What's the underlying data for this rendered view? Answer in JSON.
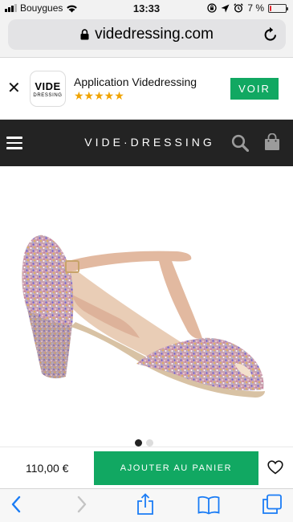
{
  "status_bar": {
    "carrier": "Bouygues",
    "time": "13:33",
    "battery_percent": "7 %",
    "battery_level": 0.07
  },
  "browser": {
    "url": "videdressing.com",
    "icons": [
      "lock-icon",
      "reload-icon"
    ]
  },
  "app_banner": {
    "logo_line1": "VIDE",
    "logo_line2": "DRESSING",
    "app_name": "Application Videdressing",
    "stars": "★★★★★",
    "rating": 5,
    "cta_label": "VOIR",
    "close_glyph": "✕"
  },
  "site_header": {
    "brand": "VIDE·DRESSING",
    "icons": [
      "hamburger-icon",
      "search-icon",
      "shopping-bag-icon"
    ]
  },
  "product": {
    "image_alt": "glitter-t-bar-sandal",
    "gallery_pages": 2,
    "gallery_active": 1
  },
  "cart_bar": {
    "price": "110,00 €",
    "add_to_cart_label": "AJOUTER AU PANIER",
    "icons": [
      "heart-icon"
    ]
  },
  "toolbar": {
    "icons": [
      "back-icon",
      "forward-icon",
      "share-icon",
      "bookmarks-icon",
      "tabs-icon"
    ]
  },
  "colors": {
    "accent_green": "#11a862",
    "header_dark": "#232323",
    "star_gold": "#f0a300",
    "ios_blue": "#1a7cf5"
  }
}
